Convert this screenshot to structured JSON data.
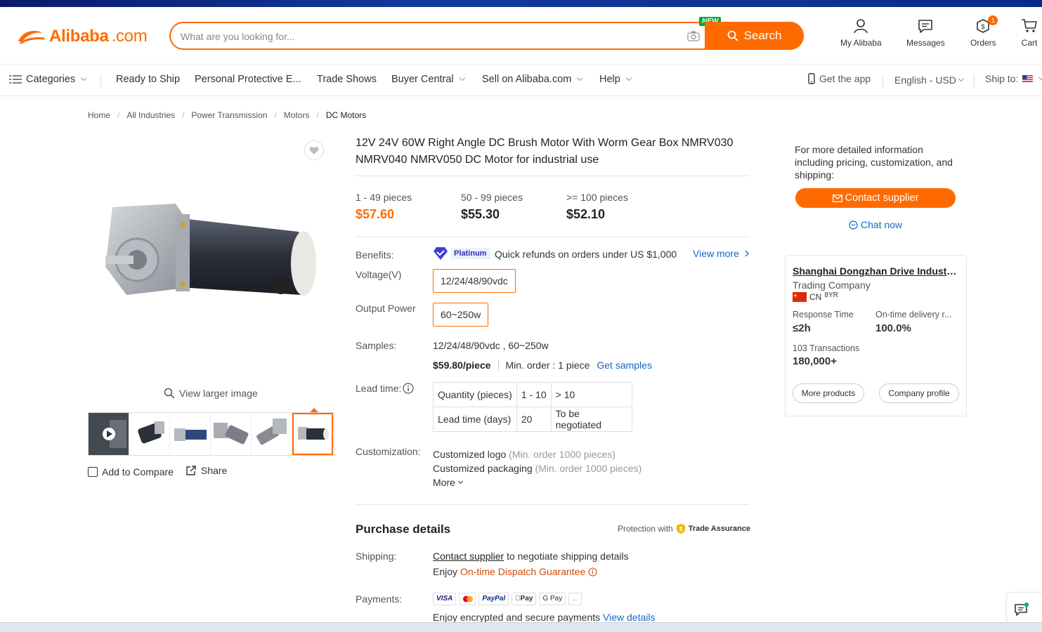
{
  "header": {
    "logo_brand": "Alibaba",
    "logo_suffix": ".com",
    "search_placeholder": "What are you looking for...",
    "new_badge": "NEW",
    "search_label": "Search",
    "my_alibaba": "My Alibaba",
    "messages": "Messages",
    "orders": "Orders",
    "orders_count": "1",
    "cart": "Cart"
  },
  "nav": {
    "categories": "Categories",
    "ready_to_ship": "Ready to Ship",
    "ppe": "Personal Protective E...",
    "trade_shows": "Trade Shows",
    "buyer_central": "Buyer Central",
    "sell": "Sell on Alibaba.com",
    "help": "Help",
    "get_app": "Get the app",
    "language": "English - USD",
    "ship_to": "Ship to:"
  },
  "breadcrumb": [
    "Home",
    "All Industries",
    "Power Transmission",
    "Motors",
    "DC Motors"
  ],
  "gallery": {
    "view_larger": "View larger image",
    "add_compare": "Add to Compare",
    "share": "Share"
  },
  "product": {
    "title": "12V 24V 60W Right Angle DC Brush Motor With Worm Gear Box NMRV030 NMRV040 NMRV050 DC Motor for industrial use",
    "tiers": [
      {
        "qty": "1 - 49 pieces",
        "price": "$57.60"
      },
      {
        "qty": "50 - 99 pieces",
        "price": "$55.30"
      },
      {
        "qty": ">= 100 pieces",
        "price": "$52.10"
      }
    ],
    "benefits_label": "Benefits:",
    "platinum": "Platinum",
    "benefit_text": "Quick refunds on orders under US $1,000",
    "view_more": "View more",
    "voltage_label": "Voltage(V)",
    "voltage_value": "12/24/48/90vdc",
    "power_label": "Output Power",
    "power_value": "60~250w",
    "samples_label": "Samples:",
    "samples_value": "12/24/48/90vdc , 60~250w",
    "sample_price": "$59.80/piece",
    "sample_min": "Min. order : 1 piece",
    "get_samples": "Get samples",
    "lead_label": "Lead time:",
    "lead_table": {
      "row1": [
        "Quantity (pieces)",
        "1 - 10",
        "> 10"
      ],
      "row2": [
        "Lead time (days)",
        "20",
        "To be negotiated"
      ]
    },
    "custom_label": "Customization:",
    "custom_logo": "Customized logo",
    "custom_logo_min": "(Min. order 1000 pieces)",
    "custom_pack": "Customized packaging",
    "custom_pack_min": "(Min. order 1000 pieces)",
    "more": "More"
  },
  "purchase": {
    "title": "Purchase details",
    "protection": "Protection with",
    "trade_assurance": "Trade Assurance",
    "shipping_label": "Shipping:",
    "contact_supplier": "Contact supplier",
    "shipping_text": "to negotiate shipping details",
    "enjoy": "Enjoy",
    "dispatch": "On-time Dispatch Guarantee",
    "payments_label": "Payments:",
    "pay_methods": [
      "VISA",
      "",
      "PayPal",
      "Pay",
      "G Pay",
      "..."
    ],
    "secure_text": "Enjoy encrypted and secure payments",
    "view_details": "View details"
  },
  "right_panel": {
    "info": "For more detailed information including pricing, customization, and shipping:",
    "contact_btn": "Contact supplier",
    "chat_now": "Chat now",
    "supplier_name": "Shanghai Dongzhan Drive Industry Co., Ltd.",
    "company_type": "Trading Company",
    "country": "CN",
    "years": "8YR",
    "response_label": "Response Time",
    "response_value": "≤2h",
    "ontime_label": "On-time delivery r...",
    "ontime_value": "100.0%",
    "transactions_label": "103 Transactions",
    "transactions_value": "180,000+",
    "more_products": "More products",
    "company_profile": "Company profile"
  },
  "colors": {
    "accent": "#ff6a00",
    "link": "#1a66c2"
  }
}
